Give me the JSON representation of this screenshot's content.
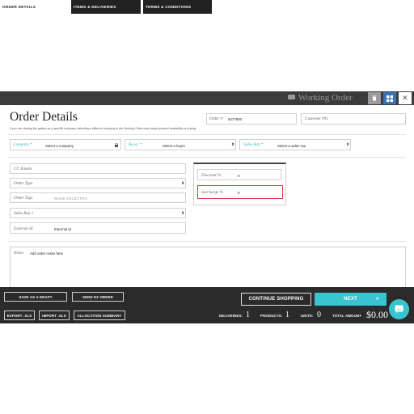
{
  "tabs": [
    {
      "label": "ORDER DETAILS"
    },
    {
      "label": "ITEMS & DELIVERIES"
    },
    {
      "label": "TERMS & CONDITIONS"
    }
  ],
  "working_order": {
    "label": "Working Order"
  },
  "header": {
    "title": "Order Details",
    "notice": "If you are viewing the gallery as a specific company, selecting a different company in the Working Order may impact product availability or pricing."
  },
  "order": {
    "number_label": "Order #",
    "number_value": "6277593",
    "customer_po_label": "Customer PO"
  },
  "row1": {
    "company": {
      "label": "Company *",
      "value": "Select a company"
    },
    "buyer": {
      "label": "Buyer *",
      "value": "Select a buyer"
    },
    "sales_rep": {
      "label": "Sales Rep *",
      "value": "Select a sales rep"
    }
  },
  "left_fields": {
    "cc_emails": {
      "label": "CC Emails"
    },
    "order_type": {
      "label": "Order Type"
    },
    "order_tags": {
      "label": "Order Tags",
      "value": "NONE SELECTED"
    },
    "sales_rep_1": {
      "label": "Sales Rep 1"
    },
    "external_id": {
      "label": "External Id",
      "value": "External Id"
    }
  },
  "adjustments": {
    "discount": {
      "label": "Discount %",
      "value": "0"
    },
    "surcharge": {
      "label": "Surcharge %",
      "value": "0"
    }
  },
  "notes": {
    "label": "Notes",
    "placeholder": "Add order notes here"
  },
  "bottom": {
    "save_draft": "SAVE AS A DRAFT",
    "send_ez": "SEND EZ ORDER",
    "export_xls": "EXPORT .XLS",
    "import_xls": "IMPORT .XLS",
    "allocation_summary": "ALLOCATION SUMMARY",
    "continue_shopping": "CONTINUE SHOPPING",
    "next": "NEXT",
    "deliveries_label": "DELIVERIES:",
    "deliveries_value": "1",
    "products_label": "PRODUCTS:",
    "products_value": "1",
    "units_label": "UNITS:",
    "units_value": "0",
    "total_label": "TOTAL AMOUNT",
    "total_value": "$0.00"
  },
  "icons": {
    "trash": "trash-icon",
    "grid": "grid-icon",
    "close": "close-icon",
    "lock": "lock-icon",
    "next_arrows": "double-chevron-right-icon",
    "chat": "chat-icon",
    "working_order": "cart-icon"
  },
  "colors": {
    "accent_teal": "#39c4cf",
    "highlight_red": "#d9443a",
    "grid_button_blue": "#3a73b8",
    "dark_bar": "#2b2b2b"
  }
}
